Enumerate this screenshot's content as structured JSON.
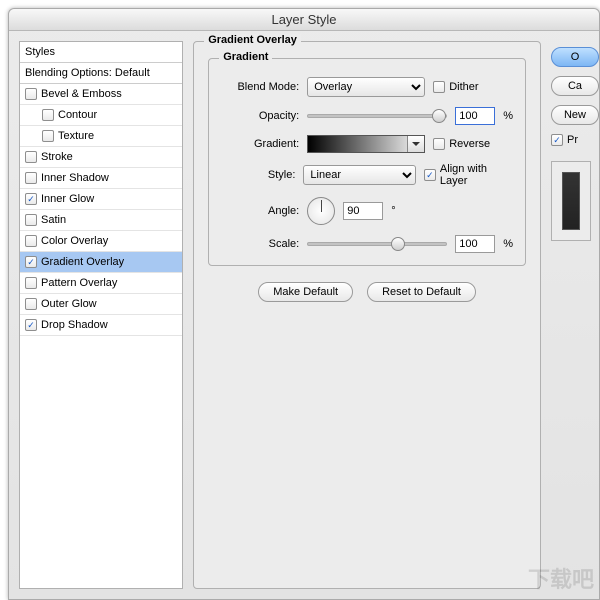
{
  "window": {
    "title": "Layer Style"
  },
  "sidebar": {
    "styles_header": "Styles",
    "blending_header": "Blending Options: Default",
    "items": [
      {
        "label": "Bevel & Emboss",
        "checked": false,
        "indent": false
      },
      {
        "label": "Contour",
        "checked": false,
        "indent": true
      },
      {
        "label": "Texture",
        "checked": false,
        "indent": true
      },
      {
        "label": "Stroke",
        "checked": false,
        "indent": false
      },
      {
        "label": "Inner Shadow",
        "checked": false,
        "indent": false
      },
      {
        "label": "Inner Glow",
        "checked": true,
        "indent": false
      },
      {
        "label": "Satin",
        "checked": false,
        "indent": false
      },
      {
        "label": "Color Overlay",
        "checked": false,
        "indent": false
      },
      {
        "label": "Gradient Overlay",
        "checked": true,
        "indent": false,
        "selected": true
      },
      {
        "label": "Pattern Overlay",
        "checked": false,
        "indent": false
      },
      {
        "label": "Outer Glow",
        "checked": false,
        "indent": false
      },
      {
        "label": "Drop Shadow",
        "checked": true,
        "indent": false
      }
    ]
  },
  "panel": {
    "title": "Gradient Overlay",
    "group_title": "Gradient",
    "labels": {
      "blend_mode": "Blend Mode:",
      "opacity": "Opacity:",
      "gradient": "Gradient:",
      "style": "Style:",
      "angle": "Angle:",
      "scale": "Scale:"
    },
    "blend_mode_value": "Overlay",
    "dither_label": "Dither",
    "dither_checked": false,
    "opacity_value": "100",
    "opacity_unit": "%",
    "reverse_label": "Reverse",
    "reverse_checked": false,
    "style_value": "Linear",
    "align_label": "Align with Layer",
    "align_checked": true,
    "angle_value": "90",
    "angle_unit": "°",
    "scale_value": "100",
    "scale_unit": "%",
    "make_default": "Make Default",
    "reset_default": "Reset to Default"
  },
  "right": {
    "ok": "O",
    "cancel": "Ca",
    "new_style": "New ",
    "preview_label": "Pr",
    "preview_checked": true
  },
  "watermark": "下载吧"
}
